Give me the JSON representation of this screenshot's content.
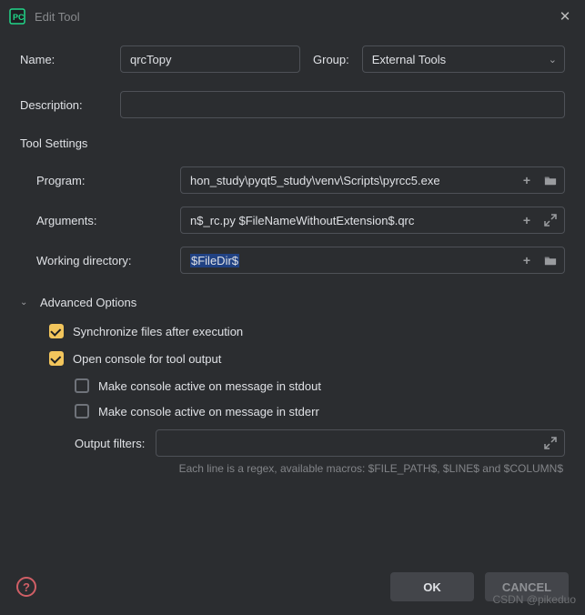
{
  "window": {
    "title": "Edit Tool"
  },
  "name": {
    "label": "Name:",
    "value": "qrcTopy"
  },
  "group": {
    "label": "Group:",
    "value": "External Tools"
  },
  "description": {
    "label": "Description:",
    "value": ""
  },
  "toolSettings": {
    "title": "Tool Settings",
    "program": {
      "label": "Program:",
      "value": "hon_study\\pyqt5_study\\venv\\Scripts\\pyrcc5.exe"
    },
    "arguments": {
      "label": "Arguments:",
      "value": "n$_rc.py $FileNameWithoutExtension$.qrc"
    },
    "workdir": {
      "label": "Working directory:",
      "value": "$FileDir$"
    }
  },
  "advanced": {
    "title": "Advanced Options",
    "sync": {
      "label": "Synchronize files after execution",
      "checked": true
    },
    "openConsole": {
      "label": "Open console for tool output",
      "checked": true
    },
    "stdout": {
      "label": "Make console active on message in stdout",
      "checked": false
    },
    "stderr": {
      "label": "Make console active on message in stderr",
      "checked": false
    },
    "outputFilters": {
      "label": "Output filters:",
      "value": ""
    },
    "hint": "Each line is a regex, available macros: $FILE_PATH$, $LINE$ and $COLUMN$"
  },
  "buttons": {
    "ok": "OK",
    "cancel": "CANCEL"
  },
  "watermark": "CSDN @pikeduo"
}
